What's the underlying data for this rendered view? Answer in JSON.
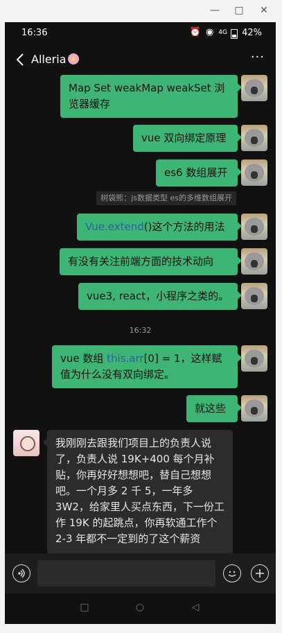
{
  "window": {
    "minimize_icon": "minimize-icon",
    "maximize_icon": "maximize-icon",
    "close_icon": "close-icon"
  },
  "status": {
    "time": "16:36",
    "network": "4G",
    "battery": "42%"
  },
  "header": {
    "title": "Alleria",
    "more_label": "···"
  },
  "messages": [
    {
      "from": "me",
      "text": "Map Set weakMap weakSet 浏览器缓存"
    },
    {
      "from": "me",
      "text": "vue 双向绑定原理"
    },
    {
      "from": "me",
      "text": "es6 数组展开"
    },
    {
      "quote": "树袋熊：js数据类型 es的多维数组展开"
    },
    {
      "from": "me",
      "link": "Vue.extend",
      "text": "()这个方法的用法"
    },
    {
      "from": "me",
      "text": "有没有关注前端方面的技术动向"
    },
    {
      "from": "me",
      "text": "vue3, react，小程序之类的。"
    },
    {
      "timestamp": "16:32"
    },
    {
      "from": "me",
      "text_a": "vue 数组 ",
      "link": "this.arr",
      "text_b": "[0] = 1，这样赋值为什么没有双向绑定。"
    },
    {
      "from": "me",
      "text": "就这些"
    },
    {
      "from": "them",
      "text": "我刚刚去跟我们项目上的负责人说了，负责人说 19K+400 每个月补贴，你再好好想想吧，替自己想想吧。一个月多 2 千 5，一年多 3W2，给家里人买点东西，下一份工作 19K 的起跳点，你再软通工作个 2-3 年都不一定到的了这个薪资"
    }
  ],
  "input": {
    "voice_icon": "voice-icon",
    "emoji_icon": "emoji-icon",
    "plus_icon": "plus-icon"
  },
  "navkeys": {
    "recent": "□",
    "home": "○",
    "back": "◁"
  }
}
